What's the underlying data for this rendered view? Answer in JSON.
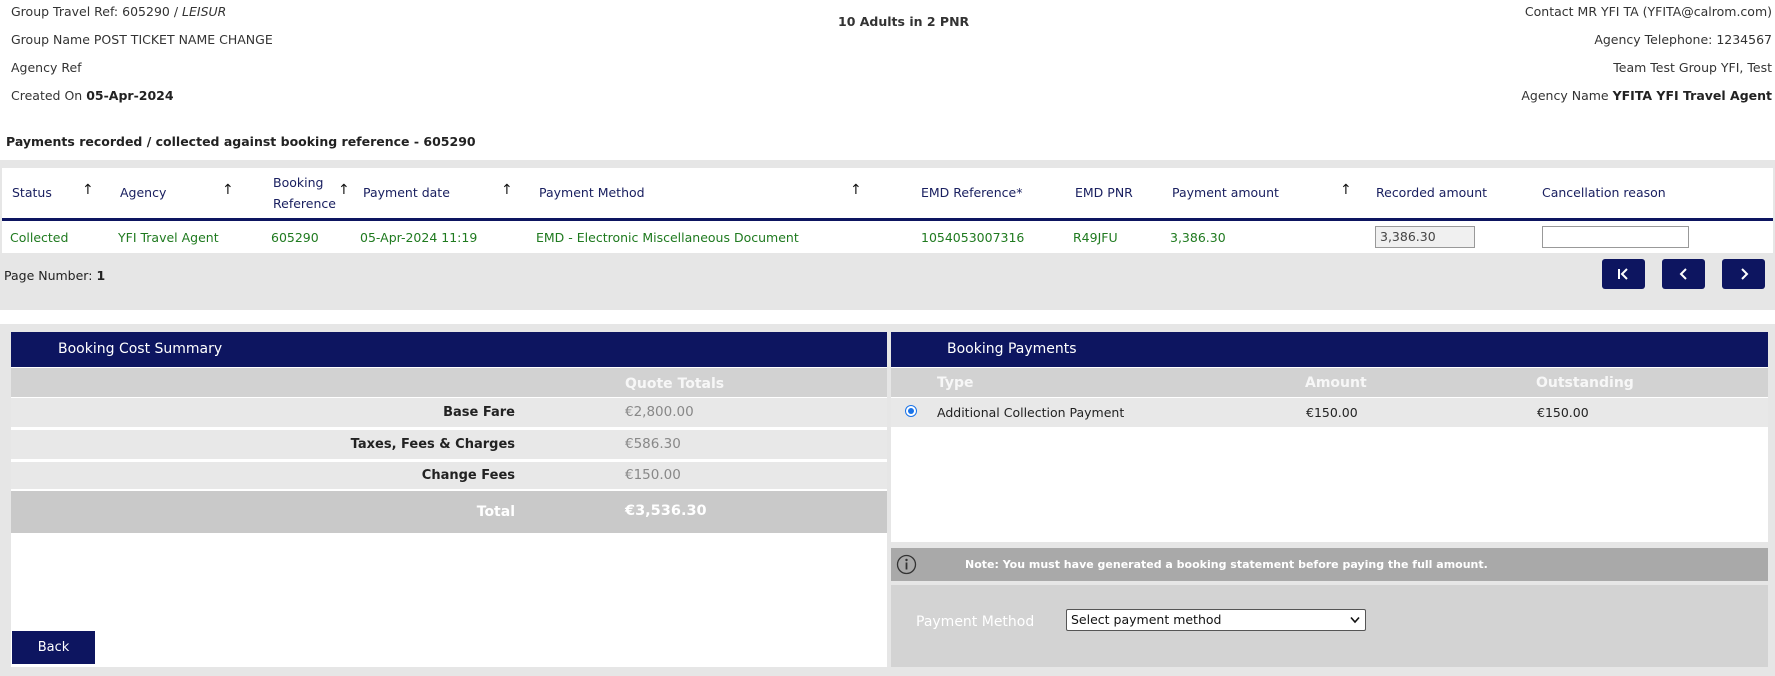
{
  "header": {
    "group_travel_ref_label": "Group Travel Ref:",
    "group_travel_ref_value": "605290 /",
    "group_travel_ref_type": "LEISUR",
    "group_name_label": "Group Name",
    "group_name_value": "POST TICKET NAME CHANGE",
    "agency_ref_label": "Agency Ref",
    "created_on_label": "Created On",
    "created_on_value": "05-Apr-2024",
    "pax_summary": "10 Adults in 2 PNR",
    "contact": "Contact MR YFI TA  (YFITA@calrom.com)",
    "agency_telephone": "Agency Telephone: 1234567",
    "team": "Team Test Group YFI, Test",
    "agency_name_label": "Agency Name",
    "agency_name_value": "YFITA YFI Travel Agent"
  },
  "payments_section_title": "Payments recorded / collected against booking reference - 605290",
  "payments_table": {
    "columns": {
      "status": "Status",
      "agency": "Agency",
      "booking_ref_line1": "Booking",
      "booking_ref_line2": "Reference",
      "payment_date": "Payment date",
      "payment_method": "Payment Method",
      "emd_reference": "EMD Reference*",
      "emd_pnr": "EMD PNR",
      "payment_amount": "Payment amount",
      "recorded_amount": "Recorded amount",
      "cancellation_reason": "Cancellation reason"
    },
    "rows": [
      {
        "status": "Collected",
        "agency": "YFI Travel Agent",
        "booking_ref": "605290",
        "payment_date": "05-Apr-2024 11:19",
        "payment_method": "EMD - Electronic Miscellaneous Document",
        "emd_reference": "1054053007316",
        "emd_pnr": "R49JFU",
        "payment_amount": "3,386.30",
        "recorded_amount": "3,386.30",
        "cancellation_reason": ""
      }
    ]
  },
  "pagination": {
    "label": "Page Number:",
    "current": "1"
  },
  "cost_summary": {
    "title": "Booking Cost Summary",
    "column_header": "Quote Totals",
    "rows": [
      {
        "label": "Base Fare",
        "value": "€2,800.00"
      },
      {
        "label": "Taxes, Fees & Charges",
        "value": "€586.30"
      },
      {
        "label": "Change Fees",
        "value": "€150.00"
      }
    ],
    "total_label": "Total",
    "total_value": "€3,536.30"
  },
  "booking_payments": {
    "title": "Booking Payments",
    "columns": {
      "type": "Type",
      "amount": "Amount",
      "outstanding": "Outstanding"
    },
    "rows": [
      {
        "type": "Additional Collection Payment",
        "amount": "€150.00",
        "outstanding": "€150.00",
        "selected": true
      }
    ],
    "note": "Note: You must have generated a booking statement before paying the full amount.",
    "payment_method_label": "Payment Method",
    "payment_method_selected": "Select payment method"
  },
  "back_label": "Back",
  "colors": {
    "navy": "#0d1560",
    "green_text": "#1f7a1f",
    "grey_band": "#e6e6e6"
  }
}
